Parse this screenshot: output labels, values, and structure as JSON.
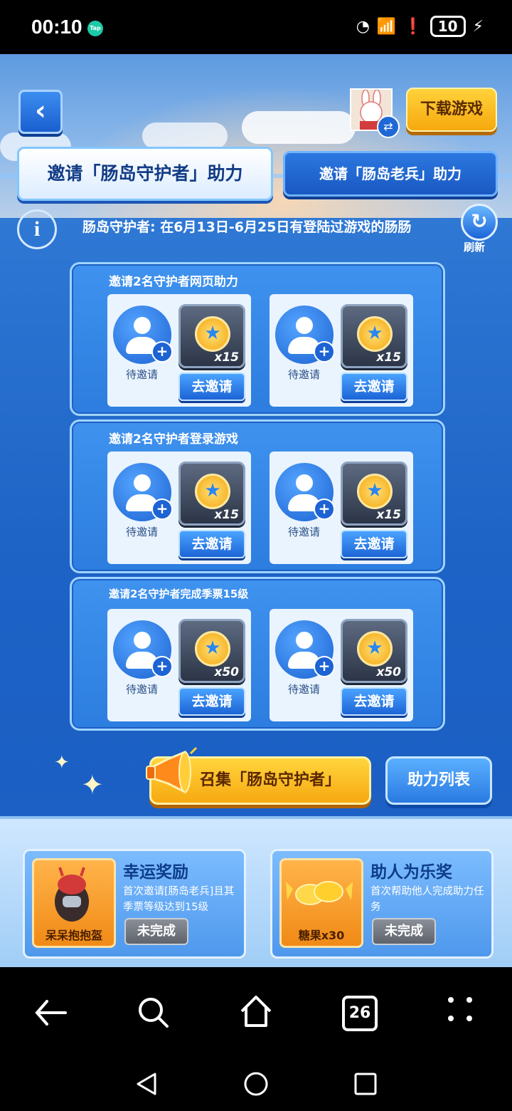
{
  "status_bar": {
    "time": "00:10",
    "tap_badge": "Tap",
    "battery": "10"
  },
  "header": {
    "download_label": "下载游戏"
  },
  "tabs": [
    {
      "label": "邀请「肠岛守护者」助力",
      "active": true
    },
    {
      "label": "邀请「肠岛老兵」助力",
      "active": false
    }
  ],
  "info": {
    "text": "肠岛守护者: 在6月13日-6月25日有登陆过游戏的肠肠",
    "refresh_label": "刷新"
  },
  "tasks": [
    {
      "title": "邀请2名守护者网页助力",
      "slots": [
        {
          "status": "待邀请",
          "reward_qty": "x15",
          "button": "去邀请"
        },
        {
          "status": "待邀请",
          "reward_qty": "x15",
          "button": "去邀请"
        }
      ]
    },
    {
      "title": "邀请2名守护者登录游戏",
      "slots": [
        {
          "status": "待邀请",
          "reward_qty": "x15",
          "button": "去邀请"
        },
        {
          "status": "待邀请",
          "reward_qty": "x15",
          "button": "去邀请"
        }
      ]
    },
    {
      "title": "邀请2名守护者完成季票15级",
      "slots": [
        {
          "status": "待邀请",
          "reward_qty": "x50",
          "button": "去邀请"
        },
        {
          "status": "待邀请",
          "reward_qty": "x50",
          "button": "去邀请"
        }
      ]
    }
  ],
  "actions": {
    "summon_label": "召集「肠岛守护者」",
    "help_list_label": "助力列表"
  },
  "bonus_rewards": [
    {
      "item": "呆呆抱抱盔",
      "title": "幸运奖励",
      "desc": "首次邀请[肠岛老兵]且其季票等级达到15级",
      "status": "未完成"
    },
    {
      "item": "糖果x30",
      "title": "助人为乐奖",
      "desc": "首次帮助他人完成助力任务",
      "status": "未完成"
    }
  ],
  "nav": {
    "tabs_count": "26"
  },
  "colors": {
    "primary_blue": "#1d63c6",
    "accent_gold": "#f7a811"
  }
}
